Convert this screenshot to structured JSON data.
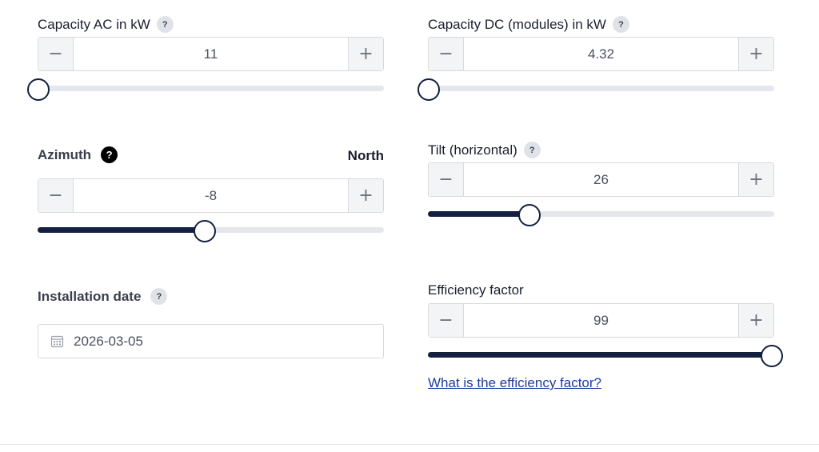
{
  "capacity_ac": {
    "label": "Capacity AC in kW",
    "help": "?",
    "value": "11",
    "minus": "−",
    "plus": "+",
    "slider_fraction": 0.0
  },
  "capacity_dc": {
    "label": "Capacity DC (modules) in kW",
    "help": "?",
    "value": "4.32",
    "minus": "−",
    "plus": "+",
    "slider_fraction": 0.0
  },
  "azimuth": {
    "label": "Azimuth",
    "help": "?",
    "direction": "North",
    "value": "-8",
    "minus": "−",
    "plus": "+",
    "slider_fraction": 0.48
  },
  "tilt": {
    "label": "Tilt (horizontal)",
    "help": "?",
    "value": "26",
    "minus": "−",
    "plus": "+",
    "slider_fraction": 0.29
  },
  "installation_date": {
    "label": "Installation date",
    "help": "?",
    "value": "2026-03-05",
    "icon": "calendar-icon"
  },
  "efficiency": {
    "label": "Efficiency factor",
    "value": "99",
    "minus": "−",
    "plus": "+",
    "slider_fraction": 0.99,
    "link": "What is the efficiency factor?"
  },
  "colors": {
    "track": "#e4e8ee",
    "fill": "#13203f",
    "link": "#1d3b9e",
    "button_bg": "#f3f4f6"
  }
}
